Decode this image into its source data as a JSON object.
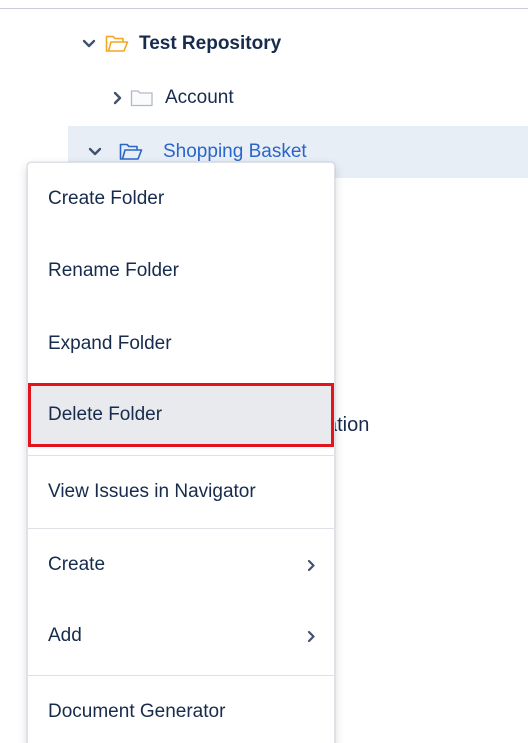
{
  "tree": {
    "root": {
      "label": "Test Repository",
      "expanded": true
    },
    "account": {
      "label": "Account",
      "expanded": false
    },
    "shopping_basket": {
      "label": "Shopping Basket",
      "expanded": true,
      "selected": true
    },
    "partial_child_label": "ation"
  },
  "context_menu": {
    "items": [
      {
        "label": "Create Folder"
      },
      {
        "label": "Rename Folder"
      },
      {
        "label": "Expand Folder"
      },
      {
        "label": "Delete Folder",
        "highlighted": true
      },
      {
        "label": "View Issues in Navigator"
      },
      {
        "label": "Create",
        "submenu": true
      },
      {
        "label": "Add",
        "submenu": true
      },
      {
        "label": "Document Generator"
      }
    ]
  },
  "colors": {
    "root_folder_icon": "#f5a623",
    "selected_row_bg": "#e8eef6",
    "link_text": "#2a66c9",
    "highlight_outline": "#e3151a"
  }
}
